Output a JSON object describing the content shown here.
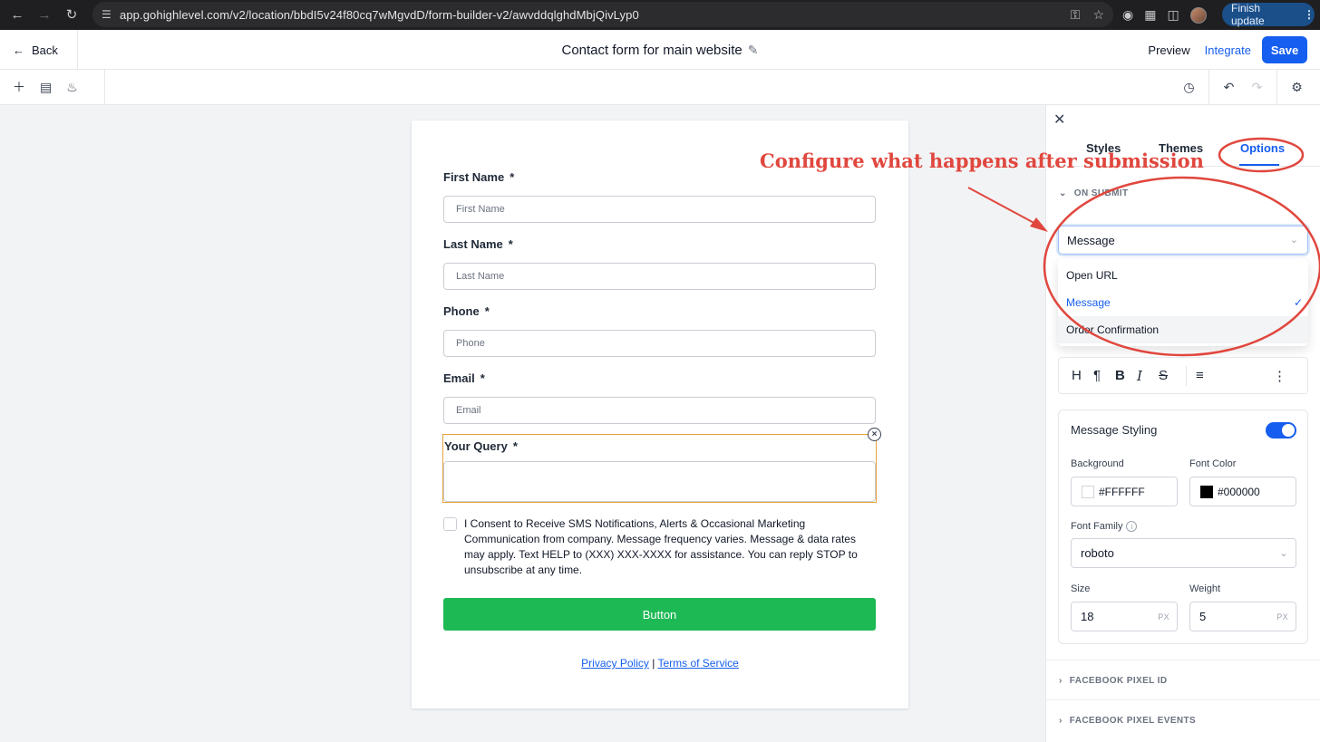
{
  "browser": {
    "url": "app.gohighlevel.com/v2/location/bbdI5v24f80cq7wMgvdD/form-builder-v2/awvddqlghdMbjQivLyp0",
    "finish_update": "Finish update"
  },
  "header": {
    "back_label": "Back",
    "form_title": "Contact form for main website",
    "preview_label": "Preview",
    "integrate_label": "Integrate",
    "save_label": "Save"
  },
  "form": {
    "fields": [
      {
        "label": "First Name",
        "required": "*",
        "placeholder": "First Name"
      },
      {
        "label": "Last Name",
        "required": "*",
        "placeholder": "Last Name"
      },
      {
        "label": "Phone",
        "required": "*",
        "placeholder": "Phone"
      },
      {
        "label": "Email",
        "required": "*",
        "placeholder": "Email"
      }
    ],
    "query": {
      "label": "Your Query",
      "required": "*"
    },
    "consent_text": "I Consent to Receive SMS Notifications, Alerts & Occasional Marketing Communication from company. Message frequency varies. Message & data rates may apply. Text HELP to (XXX) XXX-XXXX for assistance. You can reply STOP to unsubscribe at any time.",
    "button_label": "Button",
    "privacy_link": "Privacy Policy",
    "separator": "|",
    "terms_link": "Terms of Service"
  },
  "panel": {
    "tabs": [
      {
        "label": "Styles"
      },
      {
        "label": "Themes"
      },
      {
        "label": "Options"
      }
    ],
    "active_tab": "Options",
    "on_submit_label": "ON SUBMIT",
    "on_submit_selected": "Message",
    "on_submit_options": [
      "Open URL",
      "Message",
      "Order Confirmation"
    ],
    "message_styling": {
      "title": "Message Styling",
      "enabled": true,
      "background_label": "Background",
      "background_value": "#FFFFFF",
      "font_color_label": "Font Color",
      "font_color_value": "#000000",
      "font_family_label": "Font Family",
      "font_family_value": "roboto",
      "size_label": "Size",
      "size_value": "18",
      "weight_label": "Weight",
      "weight_value": "5",
      "unit": "PX"
    },
    "collapsed_sections": [
      "FACEBOOK PIXEL ID",
      "FACEBOOK PIXEL EVENTS"
    ]
  },
  "annotation": {
    "text": "Configure what happens after submission"
  },
  "colors": {
    "accent": "#155eef",
    "button_green": "#1db954",
    "annotation_red": "#e0473e"
  }
}
